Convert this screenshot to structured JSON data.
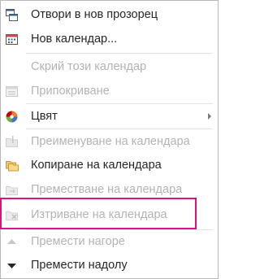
{
  "menu": {
    "items": [
      {
        "label": "Отвори в нов прозорец",
        "icon": "new-window-icon",
        "disabled": false
      },
      {
        "label": "Нов календар...",
        "icon": "new-calendar-icon",
        "disabled": false
      },
      {
        "label": "Скрий този календар",
        "icon": "",
        "disabled": true
      },
      {
        "label": "Припокриване",
        "icon": "overlay-icon",
        "disabled": true
      },
      {
        "label": "Цвят",
        "icon": "color-palette-icon",
        "disabled": false,
        "submenu": true
      },
      {
        "label": "Преименуване на календара",
        "icon": "rename-folder-icon",
        "disabled": true
      },
      {
        "label": "Копиране на календара",
        "icon": "copy-folder-icon",
        "disabled": false
      },
      {
        "label": "Преместване на календара",
        "icon": "move-folder-icon",
        "disabled": true
      },
      {
        "label": "Изтриване на календара",
        "icon": "delete-folder-icon",
        "disabled": true
      },
      {
        "label": "Премести нагоре",
        "icon": "move-up-icon",
        "disabled": true
      },
      {
        "label": "Премести надолу",
        "icon": "move-down-icon",
        "disabled": false
      }
    ]
  },
  "colors": {
    "highlight_border": "#d6157f",
    "text_enabled": "#262626",
    "text_disabled": "#b3b3b3"
  }
}
